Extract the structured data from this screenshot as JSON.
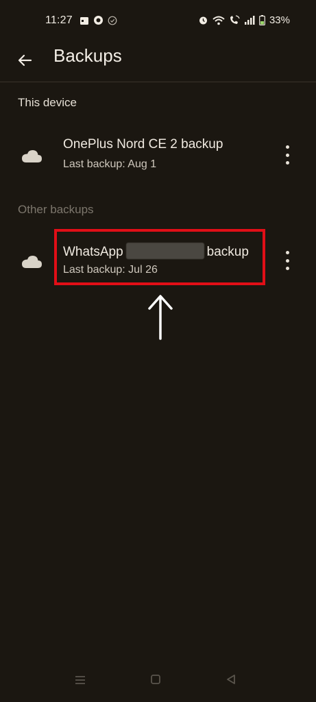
{
  "status_bar": {
    "time": "11:27",
    "battery": "33%",
    "icons": [
      "calendar-icon",
      "record-icon",
      "check-circle-icon",
      "alarm-icon",
      "wifi-icon",
      "wifi-call-icon",
      "signal-icon",
      "battery-icon"
    ]
  },
  "app_bar": {
    "back_icon": "arrow-left-icon",
    "title": "Backups"
  },
  "sections": {
    "this_device": "This device",
    "other_backups": "Other backups"
  },
  "backups": [
    {
      "icon": "cloud-icon",
      "title": "OnePlus Nord CE 2 backup",
      "subtitle": "Last backup: Aug 1"
    },
    {
      "icon": "cloud-icon",
      "title_prefix": "WhatsApp",
      "title_suffix": "backup",
      "subtitle": "Last backup: Jul 26"
    }
  ],
  "colors": {
    "background": "#1b1711",
    "highlight": "#e10e17",
    "text_primary": "#f0eae1",
    "text_muted": "#7c766c"
  },
  "nav_bar": {
    "icons": [
      "menu-lines-icon",
      "home-square-icon",
      "back-triangle-icon"
    ]
  }
}
